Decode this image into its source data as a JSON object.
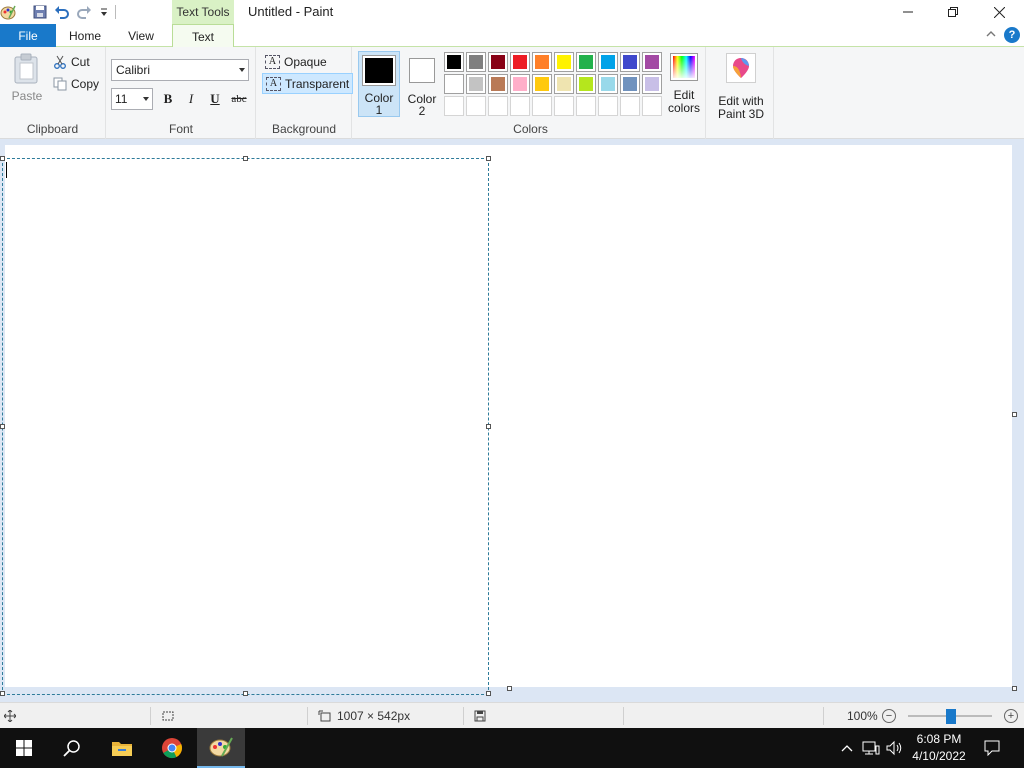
{
  "titlebar": {
    "window_title": "Untitled - Paint",
    "contextual_tab": "Text Tools",
    "quick_access_icons": [
      "paint-app-icon",
      "save-icon",
      "undo-icon",
      "redo-icon",
      "customize-quick-access-icon"
    ],
    "window_controls": [
      "minimize-icon",
      "restore-icon",
      "close-icon"
    ]
  },
  "tabs": {
    "file": "File",
    "home": "Home",
    "view": "View",
    "text": "Text",
    "active": "Text"
  },
  "ribbon": {
    "clipboard": {
      "group_label": "Clipboard",
      "paste_label": "Paste",
      "cut_label": "Cut",
      "copy_label": "Copy"
    },
    "font": {
      "group_label": "Font",
      "family": "Calibri",
      "size": "11",
      "bold": "B",
      "italic": "I",
      "underline": "U",
      "strikethrough": "abc"
    },
    "background": {
      "group_label": "Background",
      "opaque_label": "Opaque",
      "transparent_label": "Transparent",
      "selected": "Transparent"
    },
    "colors": {
      "group_label": "Colors",
      "color1_line1": "Color",
      "color1_line2": "1",
      "color2_line1": "Color",
      "color2_line2": "2",
      "color1_value": "#000000",
      "color2_value": "#ffffff",
      "palette_row1": [
        "#000000",
        "#7f7f7f",
        "#880015",
        "#ed1c24",
        "#ff7f27",
        "#fff200",
        "#22b14c",
        "#00a2e8",
        "#3f48cc",
        "#a349a4"
      ],
      "palette_row2": [
        "#ffffff",
        "#c3c3c3",
        "#b97a57",
        "#ffaec9",
        "#ffc90e",
        "#efe4b0",
        "#b5e61d",
        "#99d9ea",
        "#7092be",
        "#c8bfe7"
      ],
      "palette_row3_custom_slots": 10,
      "edit_colors_line1": "Edit",
      "edit_colors_line2": "colors"
    },
    "paint3d": {
      "line1": "Edit with",
      "line2": "Paint 3D"
    }
  },
  "canvas": {
    "background": "#ffffff",
    "text_content": ""
  },
  "statusbar": {
    "canvas_size": "1007 × 542px",
    "zoom": "100%",
    "zoom_level": 1.0
  },
  "taskbar": {
    "items": [
      "windows-start-icon",
      "search-icon",
      "file-explorer-icon",
      "chrome-icon",
      "paint-taskbar-icon"
    ],
    "active_item": "paint-taskbar-icon",
    "time": "6:08 PM",
    "date": "4/10/2022"
  },
  "accent_colors": {
    "file_tab": "#1979ca",
    "contextual_tab": "#d9f1c5",
    "selection_border": "#2e7b9a"
  }
}
